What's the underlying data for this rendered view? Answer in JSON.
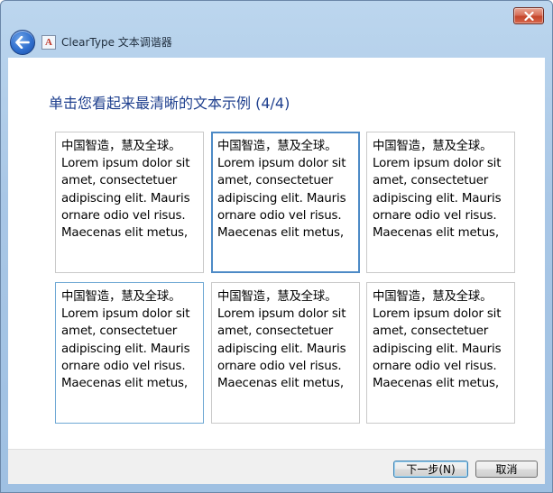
{
  "window": {
    "app_title": "ClearType 文本调谐器"
  },
  "heading": "单击您看起来最清晰的文本示例 (4/4)",
  "samples": [
    {
      "text": "中国智造，慧及全球。Lorem ipsum dolor sit amet, consectetuer adipiscing elit. Mauris ornare odio vel risus. Maecenas elit metus,",
      "state": "normal"
    },
    {
      "text": "中国智造，慧及全球。Lorem ipsum dolor sit amet, consectetuer adipiscing elit. Mauris ornare odio vel risus. Maecenas elit metus,",
      "state": "selected"
    },
    {
      "text": "中国智造，慧及全球。Lorem ipsum dolor sit amet, consectetuer adipiscing elit. Mauris ornare odio vel risus. Maecenas elit metus,",
      "state": "normal"
    },
    {
      "text": "中国智造，慧及全球。Lorem ipsum dolor sit amet, consectetuer adipiscing elit. Mauris ornare odio vel risus. Maecenas elit metus,",
      "state": "hover"
    },
    {
      "text": "中国智造，慧及全球。Lorem ipsum dolor sit amet, consectetuer adipiscing elit. Mauris ornare odio vel risus. Maecenas elit metus,",
      "state": "normal"
    },
    {
      "text": "中国智造，慧及全球。Lorem ipsum dolor sit amet, consectetuer adipiscing elit. Mauris ornare odio vel risus. Maecenas elit metus,",
      "state": "normal"
    }
  ],
  "buttons": {
    "next_label": "下一步(N)",
    "cancel_label": "取消"
  },
  "icons": {
    "close": "close-icon",
    "back": "back-arrow-icon",
    "app": "cleartype-app-icon"
  },
  "colors": {
    "heading": "#1e3f8e",
    "selected_border": "#4d8ac6",
    "hover_border": "#6fa8d4"
  }
}
